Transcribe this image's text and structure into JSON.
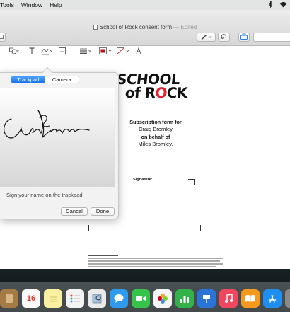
{
  "menubar": {
    "items": [
      "Tools",
      "Window",
      "Help"
    ]
  },
  "window": {
    "title": "School of Rock consent form",
    "edited": "— Edited"
  },
  "signature_popover": {
    "tabs": [
      "Trackpad",
      "Camera"
    ],
    "active_tab": "Trackpad",
    "instruction": "Sign your name on the trackpad.",
    "cancel_label": "Cancel",
    "done_label": "Done"
  },
  "document": {
    "logo_line1": "SCHOOL",
    "logo_line2_prefix": "of R",
    "logo_line2_o": "O",
    "logo_line2_suffix": "CK",
    "heading": "Subscription form for",
    "parent_name": "Craig Bromley",
    "on_behalf": "on behalf of",
    "child_name": "Miles Bromley.",
    "signature_label": "Signature:"
  },
  "dock": {
    "calendar_day": "16"
  },
  "colors": {
    "accent": "#1a73ea",
    "logo_red": "#e5232f"
  }
}
